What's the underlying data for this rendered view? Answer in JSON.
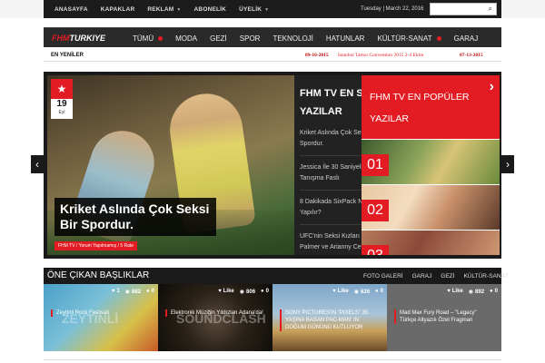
{
  "topbar": {
    "nav": [
      {
        "label": "ANASAYFA",
        "dropdown": false
      },
      {
        "label": "KAPAKLAR",
        "dropdown": false
      },
      {
        "label": "REKLAM",
        "dropdown": true
      },
      {
        "label": "ABONELİK",
        "dropdown": false
      },
      {
        "label": "ÜYELİK",
        "dropdown": true
      }
    ],
    "date": "Tuesday | March 22, 2016",
    "search_placeholder": "",
    "search_icon": "search-icon"
  },
  "mainnav": {
    "logo_part1": "FHM",
    "logo_part2": "TURKIYE",
    "items": [
      {
        "label": "TÜMÜ",
        "dot": true
      },
      {
        "label": "MODA",
        "dot": false
      },
      {
        "label": "GEZİ",
        "dot": false
      },
      {
        "label": "SPOR",
        "dot": false
      },
      {
        "label": "TEKNOLOJİ",
        "dot": false
      },
      {
        "label": "HATUNLAR",
        "dot": false
      },
      {
        "label": "KÜLTÜR-SANAT",
        "dot": true
      },
      {
        "label": "GARAJ",
        "dot": false
      }
    ]
  },
  "ticker": {
    "label": "EN YENİLER",
    "date1": "09-16-2015",
    "title1": "İstanbul Tattoo Convention 2015 2-4 Ekim",
    "date2": "07-13-2015"
  },
  "slider": {
    "badge_day": "19",
    "badge_month": "Eyl",
    "title": "Kriket Aslında Çok Seksi Bir Spordur.",
    "meta": "FHM TV / Yorum Yapılmamış / 5 Rate",
    "latest_heading": "FHM TV EN SON YAZILAR",
    "latest_items": [
      "Kriket Aslında Çok Seksi Bir Spordur.",
      "Jessica İle 30 Saniyelik Tanışma Faslı",
      "8 Dakikada SixPack Nasıl Yapılır?",
      "UFC'nin Seksi Kızları Brittney Palmer ve Arianny Celeste"
    ],
    "popular_heading": "FHM TV EN POPÜLER YAZILAR",
    "popular_numbers": [
      "01",
      "02",
      "03"
    ],
    "prev_icon": "chevron-left-icon",
    "next_icon": "chevron-right-icon"
  },
  "featured": {
    "title": "ÖNE ÇIKAN BAŞLIKLAR",
    "tabs": [
      "FOTO GALERİ",
      "GARAJ",
      "GEZİ",
      "KÜLTÜR-SANAT"
    ],
    "cards": [
      {
        "likes": "1",
        "views": "882",
        "comments": "0",
        "title": "Zeytinli Rock Festivali",
        "deco": "ZEYTİNLİ"
      },
      {
        "likes": "Like",
        "views": "806",
        "comments": "0",
        "title": "Elektronik Müziğin Yıldızları Adana'da!",
        "deco": "SOUNDCLASH"
      },
      {
        "likes": "Like",
        "views": "626",
        "comments": "0",
        "title": "SONY PICTURES'IN \"PIXELS\" 35 YAŞINA BASAN PAC-MAN' IN DOĞUM GÜNÜNÜ KUTLUYOR",
        "deco": ""
      },
      {
        "likes": "Like",
        "views": "892",
        "comments": "0",
        "title": "Mad Max Fury Road – \"Legacy\" Türkçe Altyazılı Özel Fragman",
        "deco": ""
      }
    ]
  },
  "colors": {
    "accent": "#e31b23",
    "dark": "#1a1a1a"
  }
}
